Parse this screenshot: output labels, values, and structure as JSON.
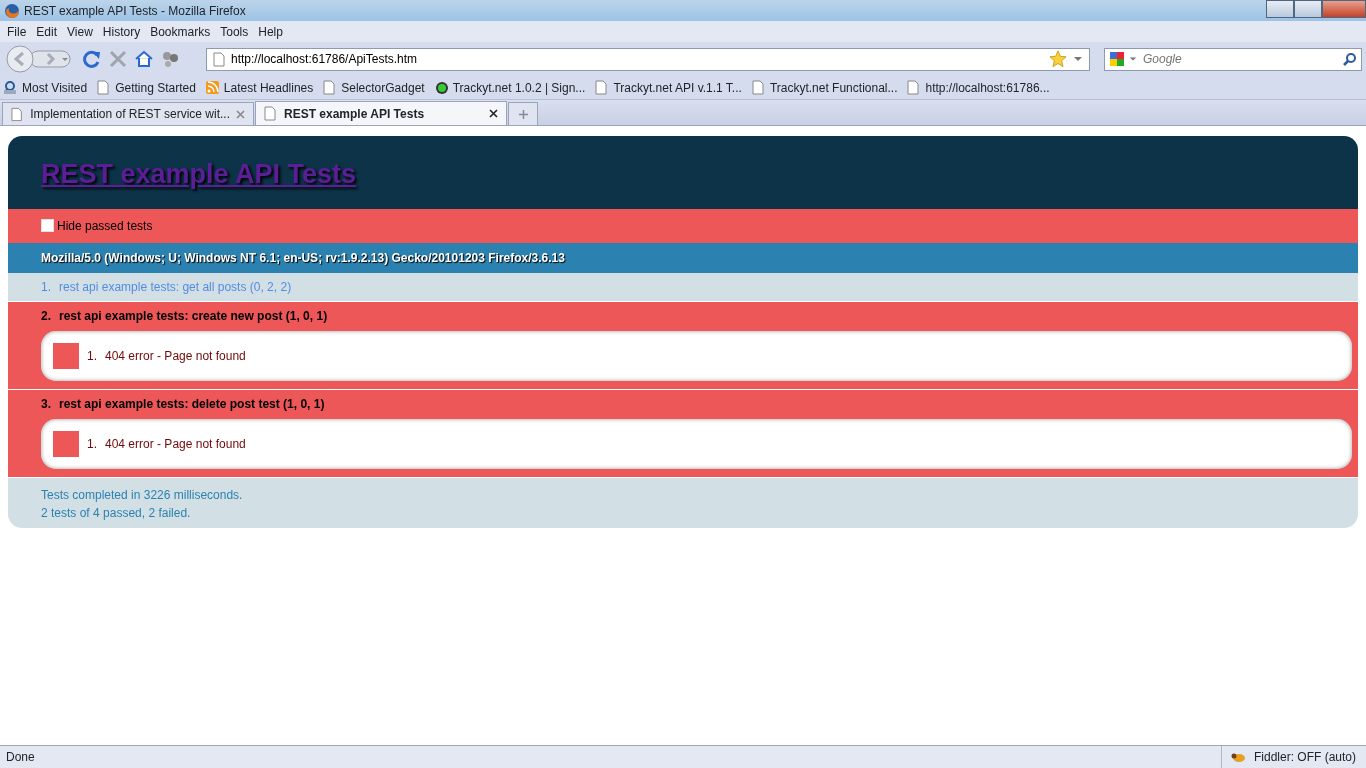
{
  "window": {
    "title": "REST example API Tests - Mozilla Firefox"
  },
  "menu": [
    "File",
    "Edit",
    "View",
    "History",
    "Bookmarks",
    "Tools",
    "Help"
  ],
  "address": {
    "value": "http://localhost:61786/ApiTests.htm"
  },
  "search": {
    "placeholder": "Google"
  },
  "bookmarks": [
    {
      "label": "Most Visited",
      "kind": "folder"
    },
    {
      "label": "Getting Started",
      "kind": "page"
    },
    {
      "label": "Latest Headlines",
      "kind": "feed"
    },
    {
      "label": "SelectorGadget",
      "kind": "page"
    },
    {
      "label": "Trackyt.net 1.0.2 | Sign...",
      "kind": "site"
    },
    {
      "label": "Trackyt.net API v.1.1 T...",
      "kind": "page"
    },
    {
      "label": "Trackyt.net Functional...",
      "kind": "page"
    },
    {
      "label": "http://localhost:61786...",
      "kind": "page"
    }
  ],
  "tabs": [
    {
      "label": "Implementation of REST service wit...",
      "selected": false
    },
    {
      "label": "REST example API Tests",
      "selected": true
    }
  ],
  "page": {
    "title": "REST example API Tests",
    "hide_passed": {
      "label": "Hide passed tests",
      "checked": false
    },
    "user_agent": "Mozilla/5.0 (Windows; U; Windows NT 6.1; en-US; rv:1.9.2.13) Gecko/20101203 Firefox/3.6.13",
    "tests": [
      {
        "number": "1.",
        "name": "rest api example tests: get all posts (0, 2, 2)",
        "passed": true
      },
      {
        "number": "2.",
        "name": "rest api example tests: create new post (1, 0, 1)",
        "passed": false,
        "failures": [
          {
            "number": "1.",
            "message": "404 error - Page not found"
          }
        ]
      },
      {
        "number": "3.",
        "name": "rest api example tests: delete post test (1, 0, 1)",
        "passed": false,
        "failures": [
          {
            "number": "1.",
            "message": "404 error - Page not found"
          }
        ]
      }
    ],
    "summary": [
      "Tests completed in 3226 milliseconds.",
      "2 tests of 4 passed, 2 failed."
    ]
  },
  "status_bar": {
    "text": "Done",
    "addon": "Fiddler: OFF (auto)"
  }
}
